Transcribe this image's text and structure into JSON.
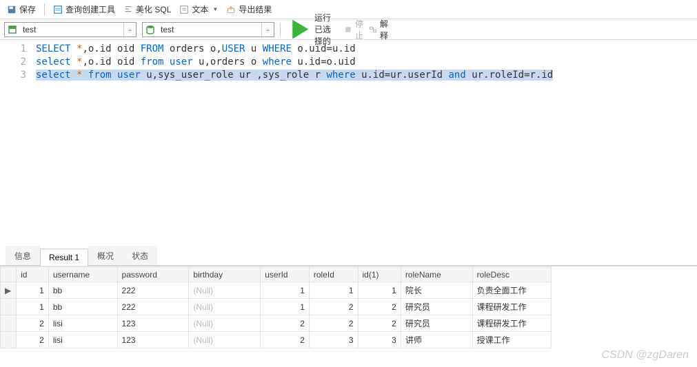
{
  "toolbar": {
    "save_label": "保存",
    "query_tool_label": "查询创建工具",
    "beautify_label": "美化 SQL",
    "text_label": "文本",
    "export_label": "导出结果"
  },
  "selectors": {
    "schema_value": "test",
    "db_value": "test"
  },
  "run": {
    "run_selected_label": "运行已选择的",
    "stop_label": "停止",
    "explain_label": "解释"
  },
  "editor": {
    "lines": [
      {
        "num": "1",
        "tokens": [
          {
            "t": "SELECT",
            "c": "kw"
          },
          {
            "t": " ",
            "c": "txt"
          },
          {
            "t": "*",
            "c": "star"
          },
          {
            "t": ",o.id oid ",
            "c": "txt"
          },
          {
            "t": "FROM",
            "c": "kw"
          },
          {
            "t": " orders o,",
            "c": "txt"
          },
          {
            "t": "USER",
            "c": "kw"
          },
          {
            "t": " u ",
            "c": "txt"
          },
          {
            "t": "WHERE",
            "c": "kw"
          },
          {
            "t": " o.uid=u.id",
            "c": "txt"
          }
        ],
        "hl": false
      },
      {
        "num": "2",
        "tokens": [
          {
            "t": "select",
            "c": "kw"
          },
          {
            "t": " ",
            "c": "txt"
          },
          {
            "t": "*",
            "c": "star"
          },
          {
            "t": ",o.id oid ",
            "c": "txt"
          },
          {
            "t": "from",
            "c": "kw"
          },
          {
            "t": " ",
            "c": "txt"
          },
          {
            "t": "user",
            "c": "kw"
          },
          {
            "t": " u,orders o ",
            "c": "txt"
          },
          {
            "t": "where",
            "c": "kw"
          },
          {
            "t": " u.id=o.uid",
            "c": "txt"
          }
        ],
        "hl": false
      },
      {
        "num": "3",
        "tokens": [
          {
            "t": "select",
            "c": "kw"
          },
          {
            "t": " ",
            "c": "txt"
          },
          {
            "t": "*",
            "c": "star"
          },
          {
            "t": " ",
            "c": "txt"
          },
          {
            "t": "from",
            "c": "kw"
          },
          {
            "t": " ",
            "c": "txt"
          },
          {
            "t": "user",
            "c": "kw"
          },
          {
            "t": " u,sys_user_role ur ,sys_role r ",
            "c": "txt"
          },
          {
            "t": "where",
            "c": "kw"
          },
          {
            "t": " u.id=ur.userId ",
            "c": "txt"
          },
          {
            "t": "and",
            "c": "kw"
          },
          {
            "t": " ur.roleId=r.id",
            "c": "txt"
          }
        ],
        "hl": true
      }
    ]
  },
  "tabs": {
    "info": "信息",
    "result1": "Result 1",
    "overview": "概况",
    "status": "状态"
  },
  "grid": {
    "columns": [
      "id",
      "username",
      "password",
      "birthday",
      "userId",
      "roleId",
      "id(1)",
      "roleName",
      "roleDesc"
    ],
    "null_label": "(Null)",
    "rows": [
      {
        "marker": "▶",
        "id": "1",
        "username": "bb",
        "password": "222",
        "birthday": null,
        "userId": "1",
        "roleId": "1",
        "id1": "1",
        "roleName": "院长",
        "roleDesc": "负责全面工作"
      },
      {
        "marker": "",
        "id": "1",
        "username": "bb",
        "password": "222",
        "birthday": null,
        "userId": "1",
        "roleId": "2",
        "id1": "2",
        "roleName": "研究员",
        "roleDesc": "课程研发工作"
      },
      {
        "marker": "",
        "id": "2",
        "username": "lisi",
        "password": "123",
        "birthday": null,
        "userId": "2",
        "roleId": "2",
        "id1": "2",
        "roleName": "研究员",
        "roleDesc": "课程研发工作"
      },
      {
        "marker": "",
        "id": "2",
        "username": "lisi",
        "password": "123",
        "birthday": null,
        "userId": "2",
        "roleId": "3",
        "id1": "3",
        "roleName": "讲师",
        "roleDesc": "授课工作"
      }
    ]
  },
  "watermark": "CSDN @zgDaren"
}
